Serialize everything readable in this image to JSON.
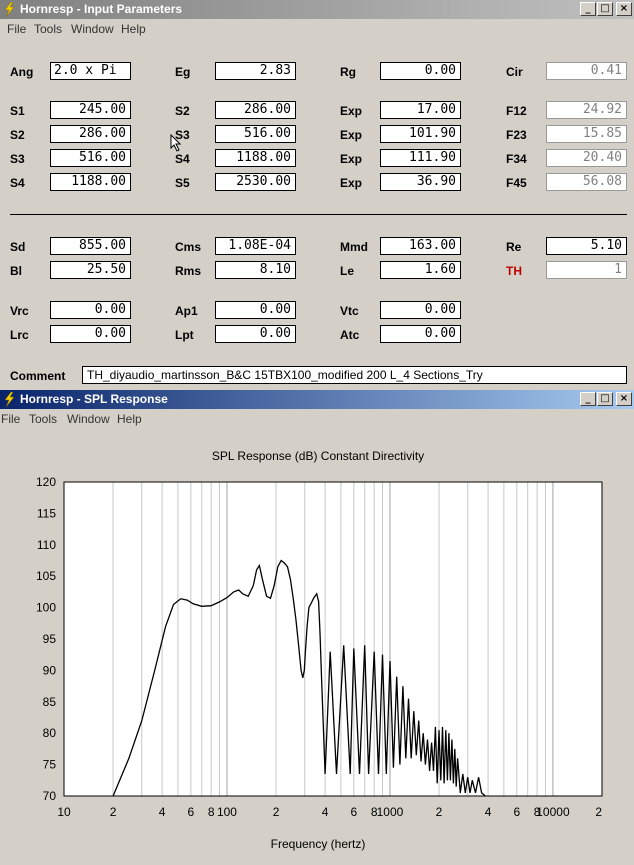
{
  "input_window": {
    "title": "Hornresp - Input Parameters",
    "menu": [
      "File",
      "Tools",
      "Window",
      "Help"
    ],
    "params": [
      {
        "label": "Ang",
        "value": "2.0 x Pi"
      },
      {
        "label": "Eg",
        "value": "2.83"
      },
      {
        "label": "Rg",
        "value": "0.00"
      },
      {
        "label": "Cir",
        "value": "0.41"
      },
      {
        "label": "S1",
        "value": "245.00"
      },
      {
        "label": "S2",
        "value": "286.00"
      },
      {
        "label": "Exp",
        "value": "17.00"
      },
      {
        "label": "F12",
        "value": "24.92"
      },
      {
        "label": "S2",
        "value": "286.00"
      },
      {
        "label": "S3",
        "value": "516.00"
      },
      {
        "label": "Exp",
        "value": "101.90"
      },
      {
        "label": "F23",
        "value": "15.85"
      },
      {
        "label": "S3",
        "value": "516.00"
      },
      {
        "label": "S4",
        "value": "1188.00"
      },
      {
        "label": "Exp",
        "value": "111.90"
      },
      {
        "label": "F34",
        "value": "20.40"
      },
      {
        "label": "S4",
        "value": "1188.00"
      },
      {
        "label": "S5",
        "value": "2530.00"
      },
      {
        "label": "Exp",
        "value": "36.90"
      },
      {
        "label": "F45",
        "value": "56.08"
      },
      {
        "label": "Sd",
        "value": "855.00"
      },
      {
        "label": "Cms",
        "value": "1.08E-04"
      },
      {
        "label": "Mmd",
        "value": "163.00"
      },
      {
        "label": "Re",
        "value": "5.10"
      },
      {
        "label": "Bl",
        "value": "25.50"
      },
      {
        "label": "Rms",
        "value": "8.10"
      },
      {
        "label": "Le",
        "value": "1.60"
      },
      {
        "label": "TH",
        "value": "1"
      },
      {
        "label": "Vrc",
        "value": "0.00"
      },
      {
        "label": "Ap1",
        "value": "0.00"
      },
      {
        "label": "Vtc",
        "value": "0.00"
      },
      {
        "label": "Lrc",
        "value": "0.00"
      },
      {
        "label": "Lpt",
        "value": "0.00"
      },
      {
        "label": "Atc",
        "value": "0.00"
      }
    ],
    "comment_label": "Comment",
    "comment_value": "TH_diyaudio_martinsson_B&C 15TBX100_modified 200 L_4 Sections_Try",
    "highlight_color": "#c00000"
  },
  "spl_window": {
    "title": "Hornresp - SPL Response",
    "menu": [
      "File",
      "Tools",
      "Window",
      "Help"
    ]
  },
  "window_buttons": {
    "minimize": "_",
    "maximize": "□",
    "close": "×"
  },
  "chart_data": {
    "type": "line",
    "title": "SPL Response (dB)   Constant Directivity",
    "xlabel": "Frequency (hertz)",
    "ylabel": "",
    "x_scale": "log",
    "xlim": [
      10,
      20000
    ],
    "ylim": [
      70,
      120
    ],
    "grid": true,
    "y_ticks": [
      "120",
      "115",
      "110",
      "105",
      "100",
      "95",
      "90",
      "85",
      "80",
      "75",
      "70"
    ],
    "x_ticks": [
      {
        "f": 10,
        "label": "10"
      },
      {
        "f": 20,
        "label": "2"
      },
      {
        "f": 40,
        "label": "4"
      },
      {
        "f": 60,
        "label": "6"
      },
      {
        "f": 80,
        "label": "8"
      },
      {
        "f": 100,
        "label": "100"
      },
      {
        "f": 200,
        "label": "2"
      },
      {
        "f": 400,
        "label": "4"
      },
      {
        "f": 600,
        "label": "6"
      },
      {
        "f": 800,
        "label": "8"
      },
      {
        "f": 1000,
        "label": "1000"
      },
      {
        "f": 2000,
        "label": "2"
      },
      {
        "f": 4000,
        "label": "4"
      },
      {
        "f": 6000,
        "label": "6"
      },
      {
        "f": 8000,
        "label": "8"
      },
      {
        "f": 10000,
        "label": "10000"
      },
      {
        "f": 20000,
        "label": "2"
      }
    ],
    "series": [
      {
        "color": "#000000",
        "x": [
          20,
          25,
          30,
          36,
          42,
          47,
          52,
          57,
          62,
          70,
          80,
          90,
          100,
          110,
          118,
          125,
          135,
          145,
          152,
          158,
          165,
          175,
          185,
          195,
          205,
          215,
          225,
          235,
          245,
          255,
          265,
          275,
          285,
          292,
          298,
          303,
          310,
          318,
          330,
          340,
          355,
          365,
          372,
          380,
          400,
          430,
          470,
          520,
          570,
          600,
          650,
          700,
          740,
          800,
          850,
          900,
          950,
          1000,
          1050,
          1100,
          1150,
          1200,
          1250,
          1300,
          1350,
          1400,
          1450,
          1500,
          1550,
          1600,
          1650,
          1700,
          1750,
          1800,
          1850,
          1900,
          1950,
          2000,
          2050,
          2100,
          2150,
          2200,
          2250,
          2300,
          2350,
          2400,
          2450,
          2500,
          2550,
          2600,
          2700,
          2800,
          2900,
          3000,
          3100,
          3200,
          3350,
          3500,
          3650,
          3850
        ],
        "y": [
          70,
          76,
          82,
          90,
          97,
          100.5,
          101.4,
          101.2,
          100.6,
          100.2,
          100.3,
          100.9,
          101.6,
          102.5,
          102.8,
          102.2,
          101.8,
          103.5,
          106,
          106.7,
          104.5,
          101.8,
          101.5,
          103.5,
          106.5,
          107.5,
          107.1,
          106.5,
          104.5,
          101.5,
          98,
          94,
          90,
          88.8,
          90,
          93,
          97,
          100,
          100.8,
          101.5,
          102.2,
          101,
          96,
          89,
          73.5,
          93,
          73.5,
          94,
          73.5,
          93.5,
          73.5,
          94,
          73.5,
          93,
          73.5,
          92.5,
          73.5,
          91.5,
          74.5,
          89,
          75,
          87.5,
          76,
          85.5,
          76,
          83.5,
          76.5,
          82,
          75.5,
          80,
          75,
          79,
          74,
          78.5,
          74,
          81,
          72,
          80.5,
          72.5,
          81,
          72,
          80.5,
          72.5,
          80,
          72.5,
          79,
          72,
          77.5,
          71.5,
          76,
          70.5,
          73.5,
          70.5,
          73,
          70.5,
          72.5,
          70.5,
          73,
          70.5,
          70
        ]
      }
    ]
  }
}
